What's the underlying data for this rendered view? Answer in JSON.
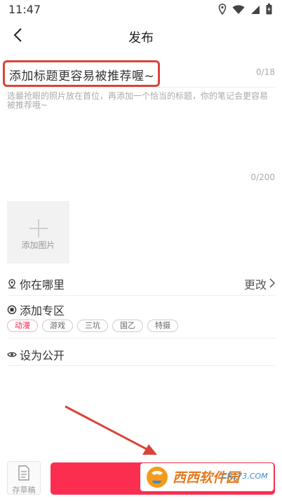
{
  "status_bar": {
    "time": "11:47"
  },
  "nav": {
    "title": "发布"
  },
  "title_input": {
    "placeholder": "添加标题更容易被推荐喔~",
    "count": "0/18"
  },
  "body_input": {
    "placeholder": "选最抢眼的照片放在首位，再添加一个恰当的标题，你的笔记会更容易被推荐哦~",
    "count": "0/200"
  },
  "add_image": {
    "label": "添加图片"
  },
  "location": {
    "label": "你在哪里",
    "action": "更改"
  },
  "zone": {
    "label": "添加专区",
    "tags": [
      {
        "label": "动漫",
        "active": true
      },
      {
        "label": "游戏",
        "active": false
      },
      {
        "label": "三坑",
        "active": false
      },
      {
        "label": "国乙",
        "active": false
      },
      {
        "label": "特摄",
        "active": false
      }
    ]
  },
  "visibility": {
    "label": "设为公开"
  },
  "bottom": {
    "draft_label": "存草稿"
  },
  "watermark": {
    "brand": "西西软件园",
    "domain": "CR173.COM"
  },
  "colors": {
    "accent": "#fb2e4f",
    "highlight_box": "#d9443a",
    "arrow": "#d9443a"
  }
}
